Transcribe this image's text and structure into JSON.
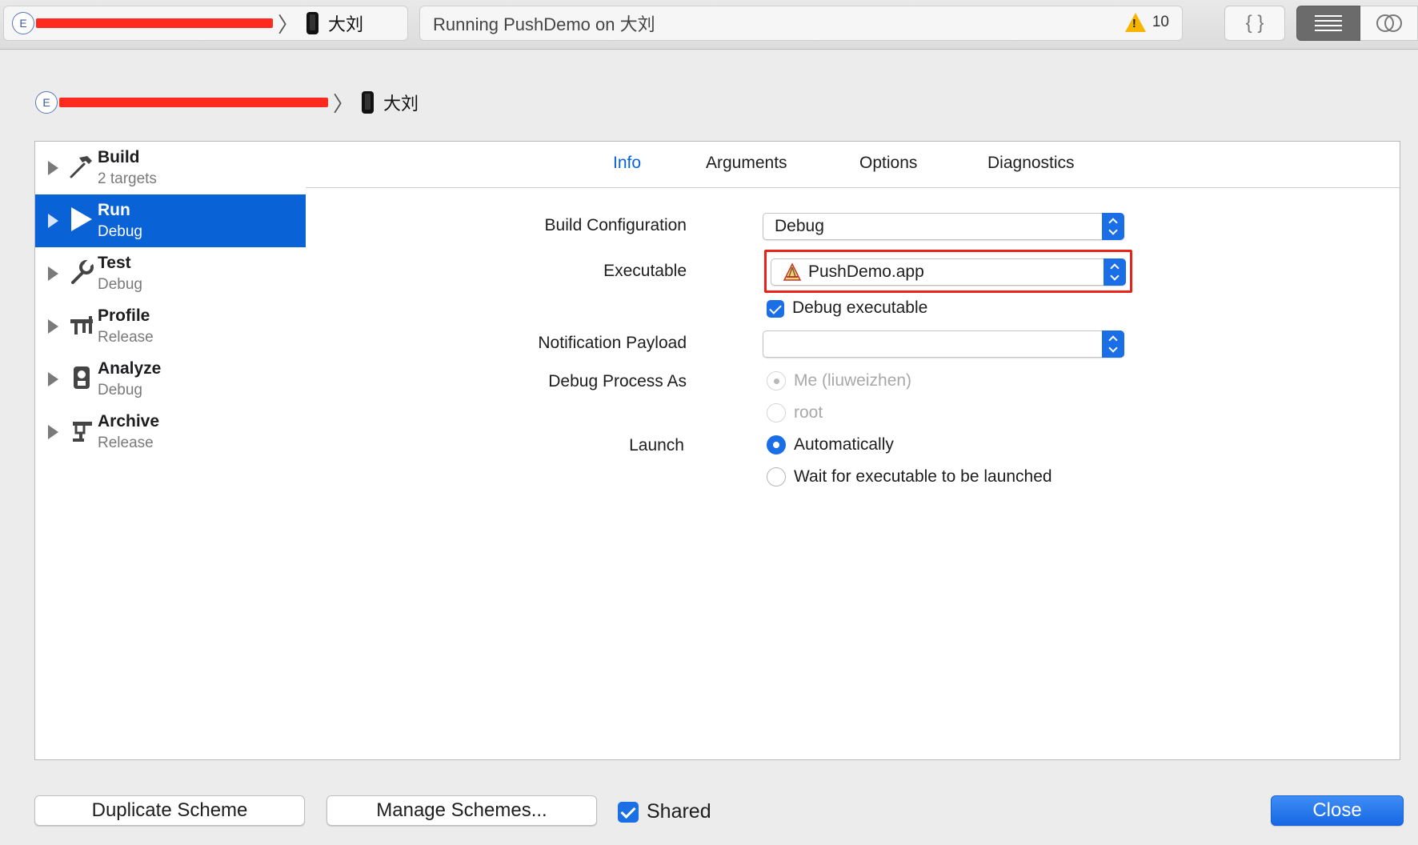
{
  "toolbar": {
    "scheme_badge": "E",
    "device": "大刘",
    "activity": "Running PushDemo on 大刘",
    "warning_count": "10",
    "braces_label": "{ }"
  },
  "sheet": {
    "scheme_badge": "E",
    "device": "大刘"
  },
  "actions": [
    {
      "title": "Build",
      "subtitle": "2 targets",
      "icon": "hammer-icon"
    },
    {
      "title": "Run",
      "subtitle": "Debug",
      "icon": "play-icon",
      "selected": true
    },
    {
      "title": "Test",
      "subtitle": "Debug",
      "icon": "wrench-icon"
    },
    {
      "title": "Profile",
      "subtitle": "Release",
      "icon": "gauge-icon"
    },
    {
      "title": "Analyze",
      "subtitle": "Debug",
      "icon": "analyze-icon"
    },
    {
      "title": "Archive",
      "subtitle": "Release",
      "icon": "archive-icon"
    }
  ],
  "tabs": [
    "Info",
    "Arguments",
    "Options",
    "Diagnostics"
  ],
  "active_tab": "Info",
  "form": {
    "build_configuration": {
      "label": "Build Configuration",
      "value": "Debug"
    },
    "executable": {
      "label": "Executable",
      "value": "PushDemo.app"
    },
    "debug_executable": {
      "label": "Debug executable",
      "checked": true
    },
    "notification_payload": {
      "label": "Notification Payload",
      "value": ""
    },
    "debug_process_as": {
      "label": "Debug Process As",
      "options": [
        "Me (liuweizhen)",
        "root"
      ],
      "selected": "Me (liuweizhen)",
      "disabled": true
    },
    "launch": {
      "label": "Launch",
      "options": [
        "Automatically",
        "Wait for executable to be launched"
      ],
      "selected": "Automatically"
    }
  },
  "footer": {
    "duplicate": "Duplicate Scheme",
    "manage": "Manage Schemes...",
    "shared": "Shared",
    "shared_checked": true,
    "close": "Close"
  },
  "colors": {
    "accent": "#1a6ee6",
    "selection": "#0963d6",
    "highlight_box": "#e8231a",
    "redaction": "#ff2a1f",
    "warning": "#f5b500"
  }
}
